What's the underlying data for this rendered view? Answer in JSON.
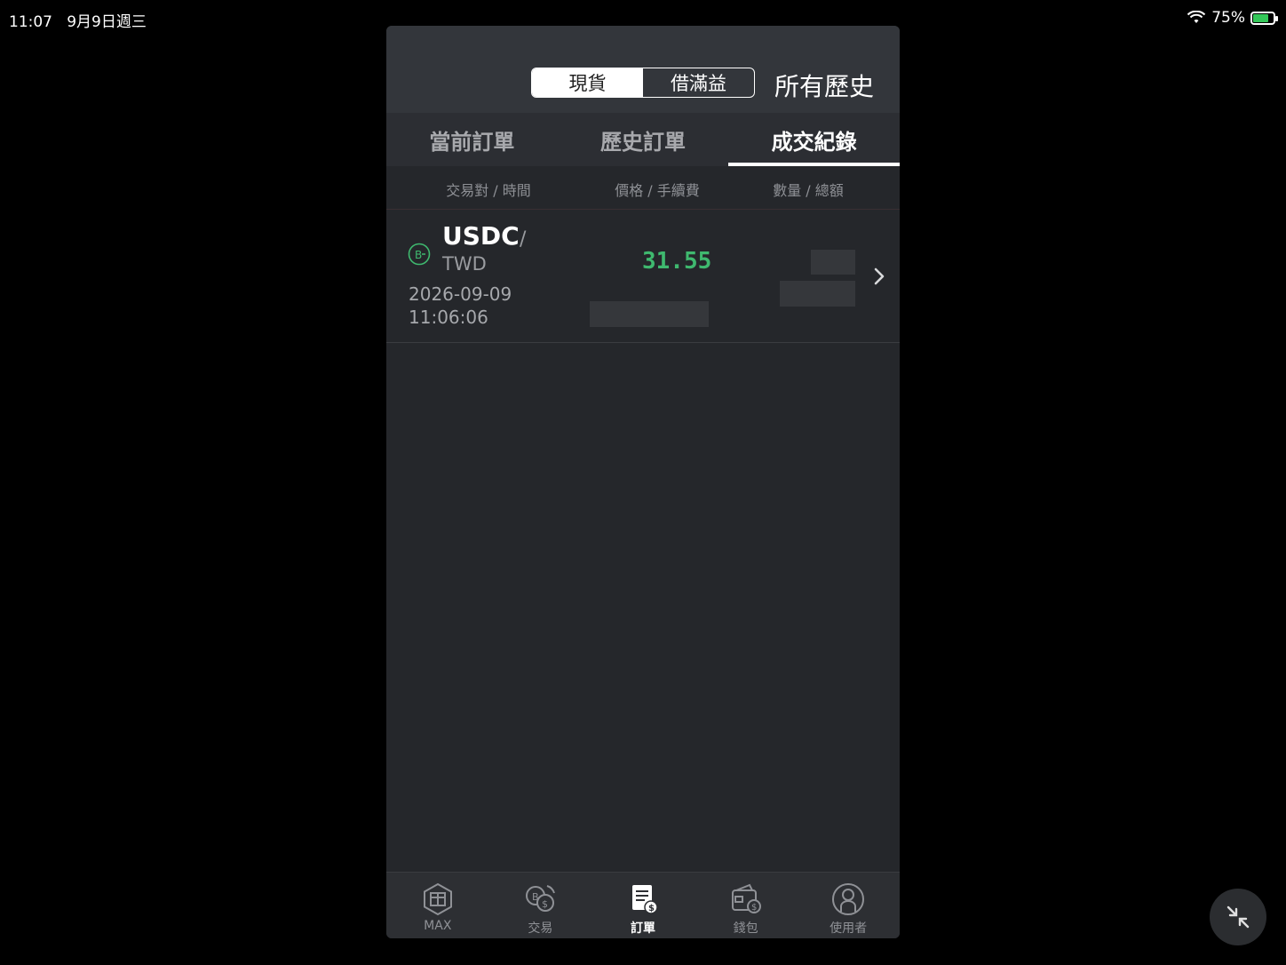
{
  "status_bar": {
    "time": "11:07",
    "date": "9月9日週三",
    "battery": "75%",
    "battery_level": 0.75
  },
  "segment": {
    "options": [
      "現貨",
      "借滿益"
    ],
    "selected": "現貨"
  },
  "header": {
    "all_history": "所有歷史"
  },
  "tabs": [
    {
      "label": "當前訂單",
      "active": false
    },
    {
      "label": "歷史訂單",
      "active": false
    },
    {
      "label": "成交紀錄",
      "active": true
    }
  ],
  "columns": [
    "交易對 / 時間",
    "價格 / 手續費",
    "數量 / 總額"
  ],
  "trades": [
    {
      "base": "USDC",
      "slash": "/",
      "quote": "TWD",
      "date": "2026-09-09",
      "time": "11:06:06",
      "price": "31.55"
    }
  ],
  "bottom_nav": [
    {
      "label": "MAX",
      "icon": "max-logo-icon",
      "active": false
    },
    {
      "label": "交易",
      "icon": "exchange-icon",
      "active": false
    },
    {
      "label": "訂單",
      "icon": "orders-icon",
      "active": true
    },
    {
      "label": "錢包",
      "icon": "wallet-icon",
      "active": false
    },
    {
      "label": "使用者",
      "icon": "user-icon",
      "active": false
    }
  ],
  "colors": {
    "price_up": "#3fb96f",
    "background": "#25272b"
  }
}
